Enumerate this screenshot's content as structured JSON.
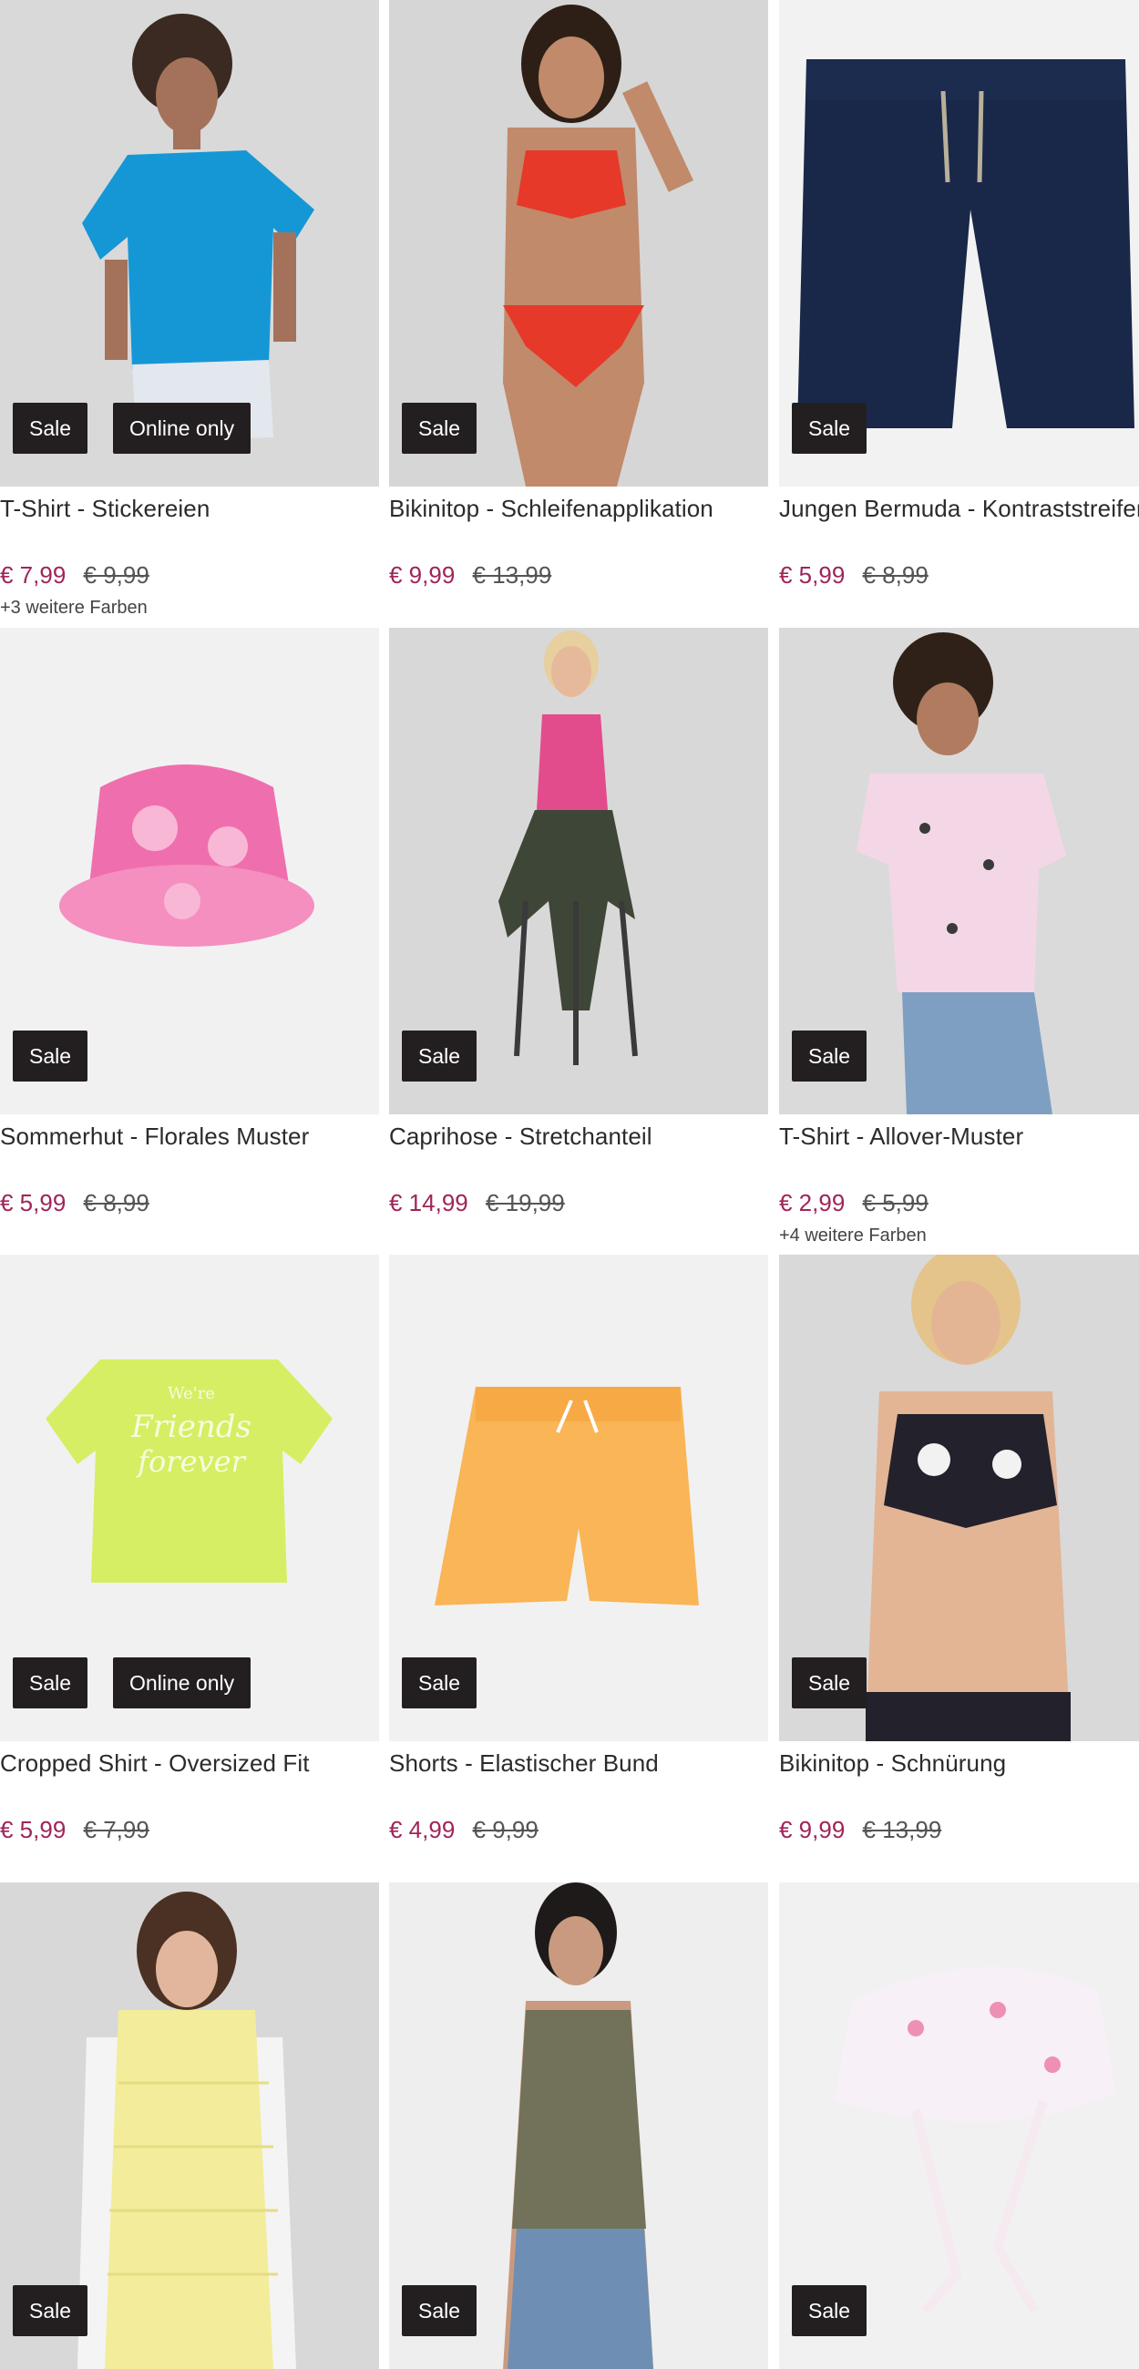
{
  "products": [
    {
      "title": "T-Shirt - Stickereien",
      "price": "€ 7,99",
      "old_price": "€ 9,99",
      "badges": [
        "Sale",
        "Online only"
      ],
      "more_colors": "+3 weitere Farben"
    },
    {
      "title": "Bikinitop - Schleifenapplikation",
      "price": "€ 9,99",
      "old_price": "€ 13,99",
      "badges": [
        "Sale"
      ],
      "more_colors": ""
    },
    {
      "title": "Jungen Bermuda - Kontraststreifen",
      "price": "€ 5,99",
      "old_price": "€ 8,99",
      "badges": [
        "Sale"
      ],
      "more_colors": ""
    },
    {
      "title": "Sommerhut - Florales Muster",
      "price": "€ 5,99",
      "old_price": "€ 8,99",
      "badges": [
        "Sale"
      ],
      "more_colors": ""
    },
    {
      "title": "Caprihose - Stretchanteil",
      "price": "€ 14,99",
      "old_price": "€ 19,99",
      "badges": [
        "Sale"
      ],
      "more_colors": ""
    },
    {
      "title": "T-Shirt - Allover-Muster",
      "price": "€ 2,99",
      "old_price": "€ 5,99",
      "badges": [
        "Sale"
      ],
      "more_colors": "+4 weitere Farben"
    },
    {
      "title": "Cropped Shirt - Oversized Fit",
      "price": "€ 5,99",
      "old_price": "€ 7,99",
      "badges": [
        "Sale",
        "Online only"
      ],
      "more_colors": "",
      "print_text": [
        "We're",
        "Friends",
        "forever"
      ]
    },
    {
      "title": "Shorts - Elastischer Bund",
      "price": "€ 4,99",
      "old_price": "€ 9,99",
      "badges": [
        "Sale"
      ],
      "more_colors": ""
    },
    {
      "title": "Bikinitop - Schnürung",
      "price": "€ 9,99",
      "old_price": "€ 13,99",
      "badges": [
        "Sale"
      ],
      "more_colors": ""
    },
    {
      "title": "",
      "price": "",
      "old_price": "",
      "badges": [
        "Sale"
      ],
      "more_colors": ""
    },
    {
      "title": "",
      "price": "",
      "old_price": "",
      "badges": [
        "Sale"
      ],
      "more_colors": ""
    },
    {
      "title": "",
      "price": "",
      "old_price": "",
      "badges": [
        "Sale"
      ],
      "more_colors": ""
    }
  ],
  "colors": {
    "sale_price": "#a0245a",
    "badge_bg": "#231f20"
  }
}
